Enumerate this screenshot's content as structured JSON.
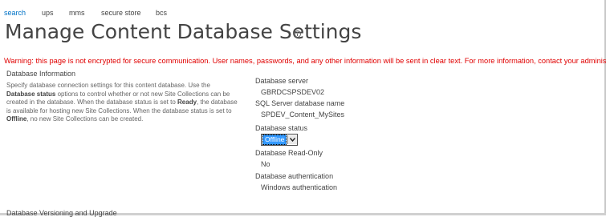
{
  "nav": {
    "items": [
      {
        "label": "search",
        "active": true
      },
      {
        "label": "ups",
        "active": false
      },
      {
        "label": "mms",
        "active": false
      },
      {
        "label": "secure store",
        "active": false
      },
      {
        "label": "bcs",
        "active": false
      }
    ]
  },
  "page": {
    "title": "Manage Content Database Settings",
    "title_icon": "info-icon"
  },
  "warning": "Warning: this page is not encrypted for secure communication. User names, passwords, and any other information will be sent in clear text. For more information, contact your administrator.",
  "section": {
    "title": "Database Information",
    "desc": {
      "p1": "Specify database connection settings for this content database. Use the ",
      "b1": "Database status",
      "p2": " options to control whether or not new Site Collections can be created in the database. When the database status is set to ",
      "b2": "Ready",
      "p3": ", the database is available for hosting new Site Collections. When the database status is set to ",
      "b3": "Offline",
      "p4": ", no new Site Collections can be created."
    }
  },
  "fields": {
    "server_label": "Database server",
    "server_value": "GBRDCSPSDEV02",
    "dbname_label": "SQL Server database name",
    "dbname_value": "SPDEV_Content_MySites",
    "status_label": "Database status",
    "status_value": "Offline",
    "status_icon": "chevron-down-icon",
    "readonly_label": "Database Read-Only",
    "readonly_value": "No",
    "auth_label": "Database authentication",
    "auth_value": "Windows authentication"
  },
  "next_section": {
    "title": "Database Versioning and Upgrade"
  },
  "colors": {
    "link_active": "#0072c6",
    "warning": "#e00000",
    "select_highlight": "#3399ff"
  }
}
